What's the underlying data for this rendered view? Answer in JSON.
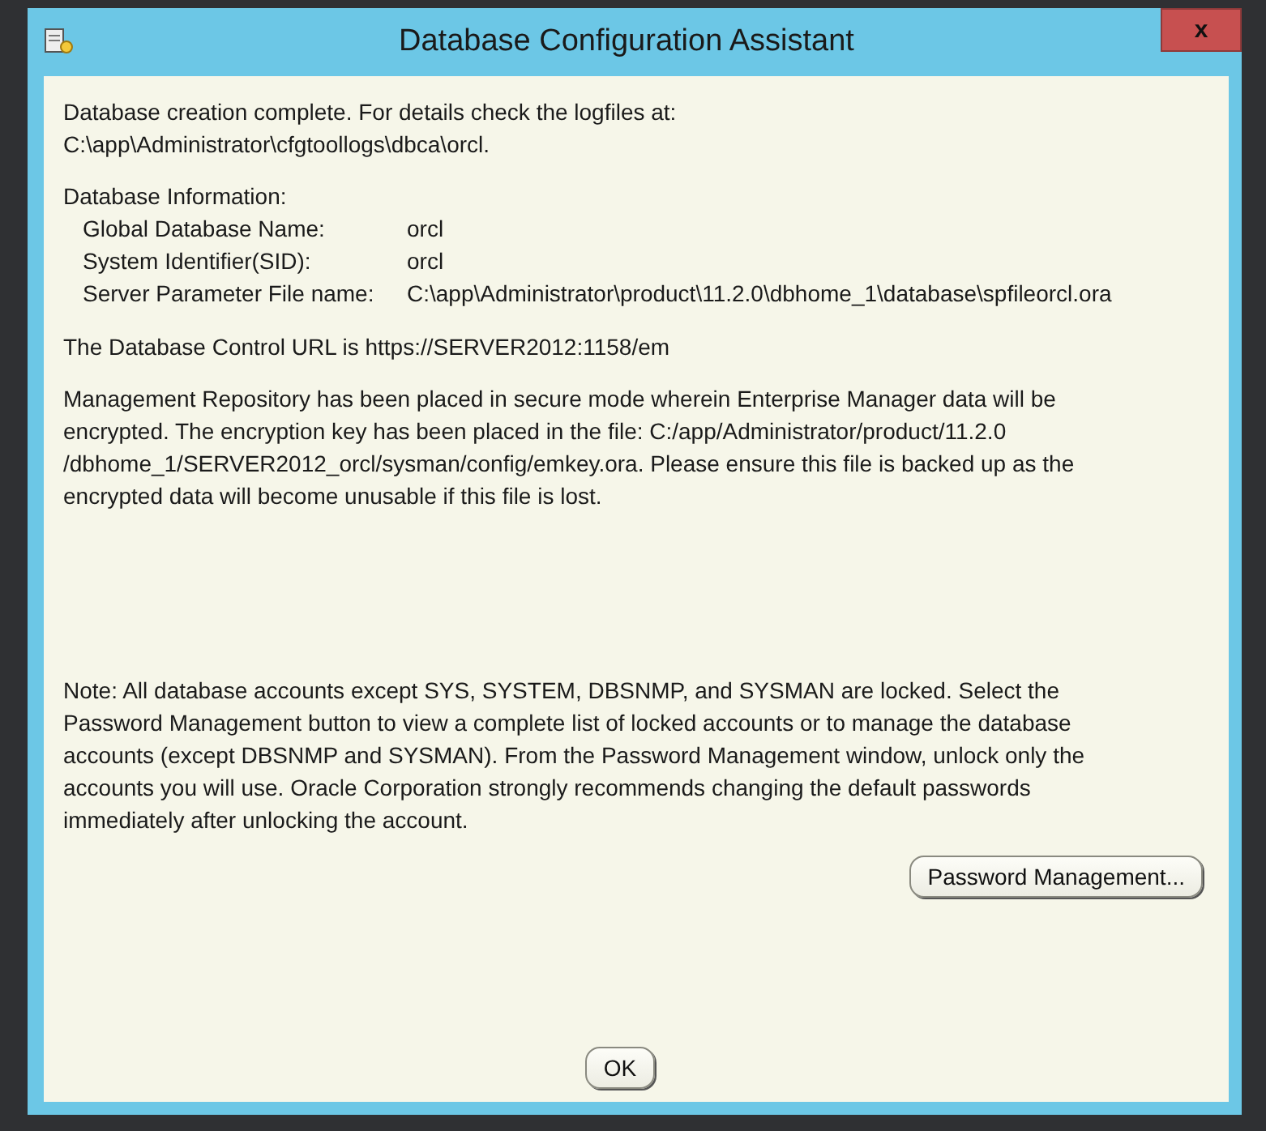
{
  "window": {
    "title": "Database Configuration Assistant",
    "close_label": "x"
  },
  "completion": {
    "message": "Database creation complete. For details check the logfiles at:",
    "log_path": "C:\\app\\Administrator\\cfgtoollogs\\dbca\\orcl."
  },
  "database_information": {
    "heading": "Database Information:",
    "rows": [
      {
        "label": "Global Database Name:",
        "value": "orcl"
      },
      {
        "label": "System Identifier(SID):",
        "value": "orcl"
      },
      {
        "label": "Server Parameter File name:",
        "value": "C:\\app\\Administrator\\product\\11.2.0\\dbhome_1\\database\\spfileorcl.ora"
      }
    ]
  },
  "control_url": "The Database Control URL is https://SERVER2012:1158/em",
  "repository_note": "Management Repository has been placed in secure mode wherein Enterprise Manager data will be\nencrypted.  The encryption key has been placed in the file: C:/app/Administrator/product/11.2.0\n/dbhome_1/SERVER2012_orcl/sysman/config/emkey.ora.   Please ensure this file is backed up as the\nencrypted data will become unusable if this file is lost.",
  "accounts_note": "Note: All database accounts except SYS, SYSTEM, DBSNMP, and SYSMAN are locked. Select the\nPassword Management button to view a complete list of locked accounts or to manage the database\naccounts (except DBSNMP and SYSMAN). From the Password Management window, unlock only the\naccounts you will use. Oracle Corporation strongly recommends changing the default passwords\nimmediately after unlocking the account.",
  "buttons": [
    {
      "kind": "side",
      "label": "Password Management..."
    },
    {
      "kind": "bottom",
      "label": "OK"
    }
  ]
}
